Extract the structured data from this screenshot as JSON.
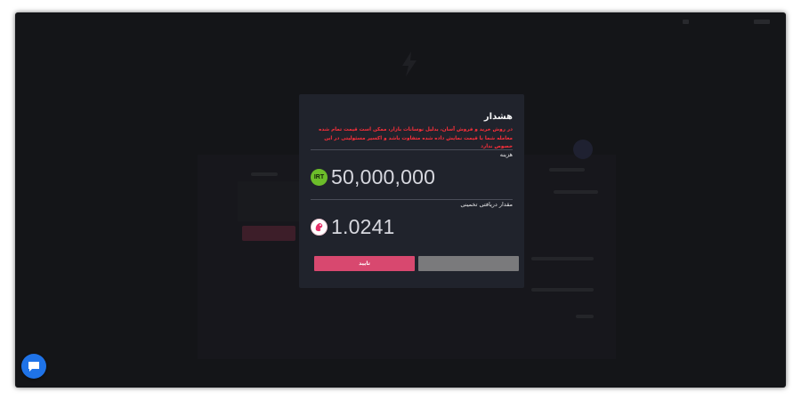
{
  "modal": {
    "title": "هشدار",
    "warning": "در روش خرید و فروش آسان، بدلیل نوسانات بازار، ممکن است قیمت تمام شده معامله شما با قیمت نمایش داده شده متفاوت باشد و اکسیر مسئولیتی در این خصوص ندارد",
    "cost_label": "هزینه",
    "cost_currency_icon": "IRT",
    "cost_amount": "50,000,000",
    "estimate_label": "مقدار دریافتی تخمینی",
    "estimate_amount": "1.0241",
    "confirm_label": "تایید",
    "cancel_label": ""
  },
  "colors": {
    "accent": "#d8486f",
    "warning": "#ff2f3a",
    "irt_green": "#6cbd2a",
    "chat_blue": "#1f73e8"
  },
  "icons": {
    "cost_coin": "irt-coin-icon",
    "estimate_coin": "crypto-coin-icon",
    "chat": "chat-bubble-icon"
  }
}
